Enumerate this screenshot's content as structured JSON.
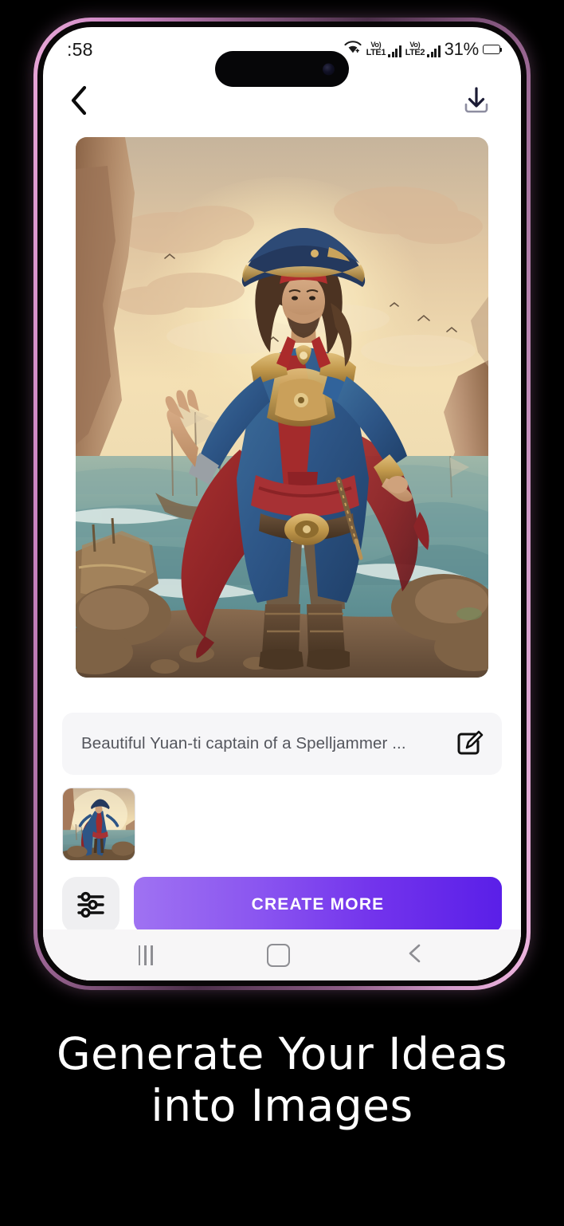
{
  "device": {
    "frame_color": "#c982c0",
    "status_bar": {
      "clock": ":58",
      "wifi_icon": "wifi-icon",
      "sim1_volte": "Vo)",
      "sim1_label": "LTE1",
      "sim2_volte": "Vo)",
      "sim2_label": "LTE2",
      "battery_percent": "31%"
    },
    "nav_bar": {
      "recents_label": "recents-icon",
      "home_label": "home-icon",
      "back_label": "back-icon"
    }
  },
  "app": {
    "header": {
      "back_icon": "chevron-left-icon",
      "download_icon": "download-icon"
    },
    "hero": {
      "alt": "Fantasy pirate captain standing on rocky shore with ship and waves",
      "palette": {
        "sky_light": "#f6e3bf",
        "sky_glow": "#fbf0cf",
        "cloud": "#dcb79a",
        "cliff": "#a5785c",
        "sea": "#6f9a96",
        "coat_blue": "#2f5f93",
        "cape_red": "#9c2b2f",
        "gold": "#c59a4e",
        "sand": "#8a6b4f"
      }
    },
    "prompt": {
      "text": "Beautiful Yuan-ti captain of a Spelljammer ...",
      "edit_icon": "edit-pencil-icon"
    },
    "thumbnails": [
      {
        "alt": "generated pirate captain thumbnail"
      }
    ],
    "actions": {
      "settings_icon": "sliders-settings-icon",
      "create_label": "CREATE MORE",
      "create_gradient_from": "#9f72f2",
      "create_gradient_to": "#5a1fe8"
    }
  },
  "caption": {
    "line1": "Generate Your  Ideas",
    "line2": "into  Images"
  }
}
